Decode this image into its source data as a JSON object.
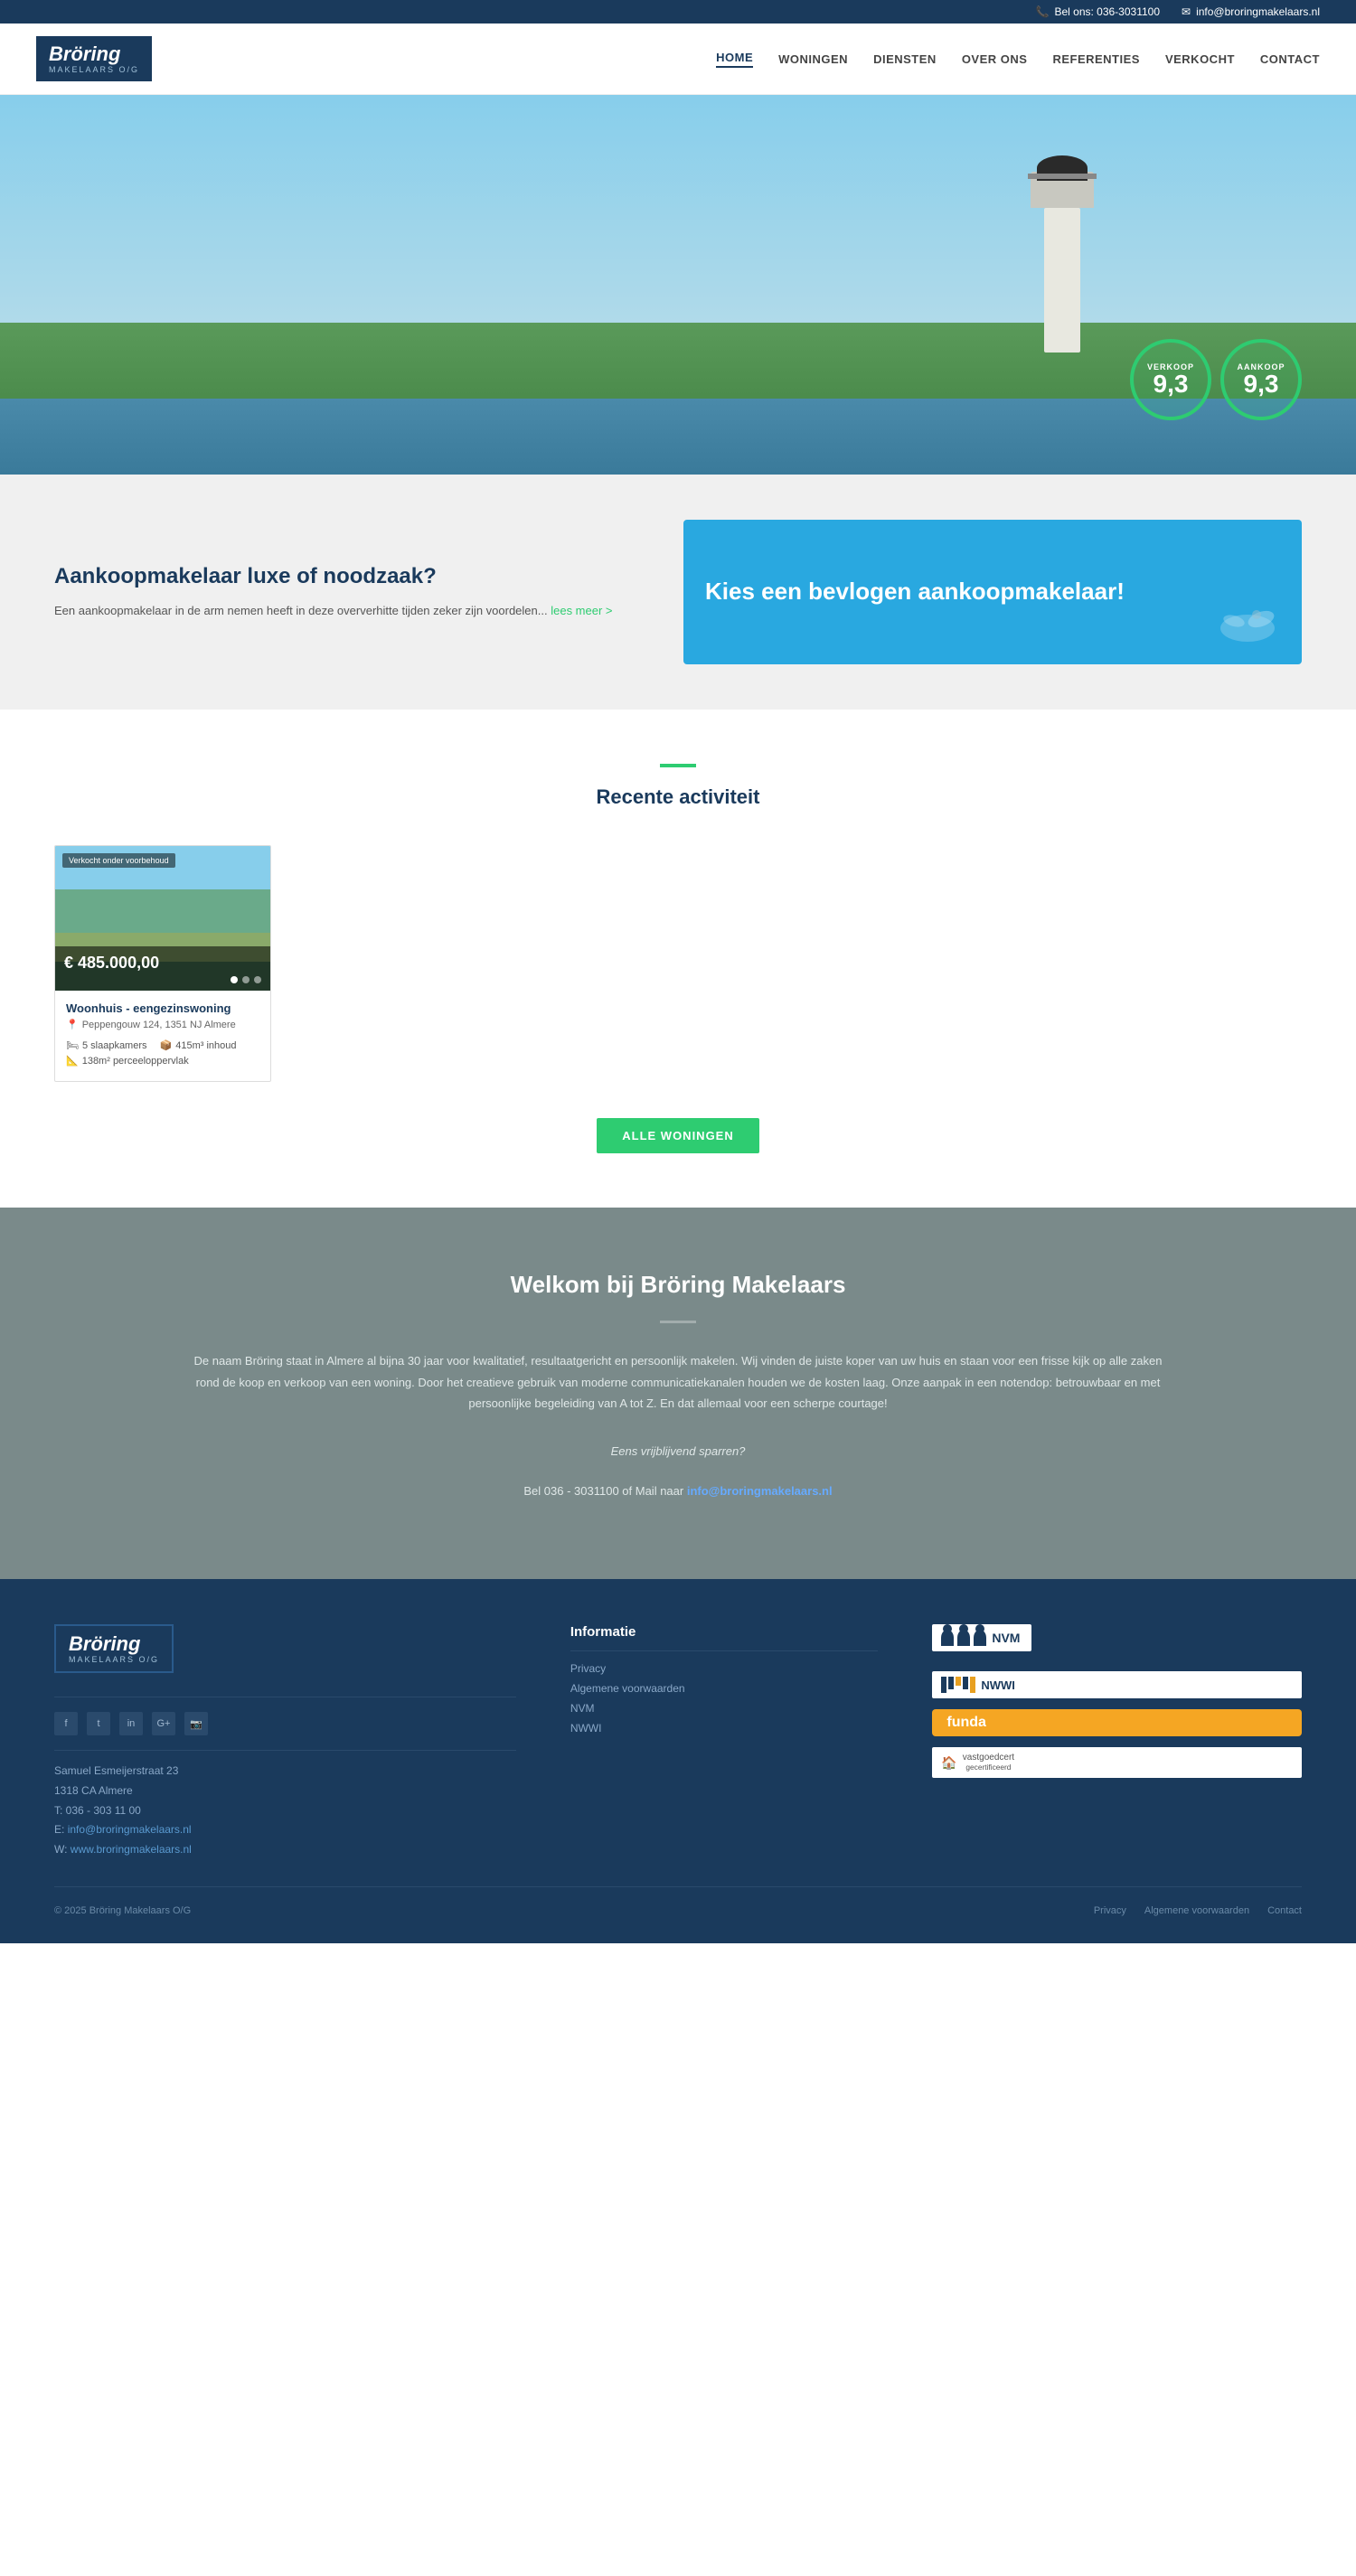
{
  "topbar": {
    "phone_icon": "📞",
    "phone": "Bel ons: 036-3031100",
    "email_icon": "✉",
    "email": "info@broringmakelaars.nl"
  },
  "header": {
    "logo_line1": "Bröring",
    "logo_line2": "MAKELAARS O/G",
    "nav": [
      {
        "label": "HOME",
        "active": true
      },
      {
        "label": "WONINGEN",
        "active": false
      },
      {
        "label": "DIENSTEN",
        "active": false
      },
      {
        "label": "OVER ONS",
        "active": false
      },
      {
        "label": "REFERENTIES",
        "active": false
      },
      {
        "label": "VERKOCHT",
        "active": false
      },
      {
        "label": "CONTACT",
        "active": false
      }
    ]
  },
  "hero": {
    "badge_verkoop_label": "VERKOOP",
    "badge_verkoop_score": "9,3",
    "badge_aankoop_label": "AANKOOP",
    "badge_aankoop_score": "9,3"
  },
  "promo": {
    "heading": "Aankoopmakelaar luxe of noodzaak?",
    "body": "Een aankoopmakelaar in de arm nemen heeft in deze oververhitte tijden zeker zijn voordelen...",
    "link_text": "lees meer >",
    "banner_text": "Kies een bevlogen aankoopmakelaar!"
  },
  "recent": {
    "accent": true,
    "title": "Recente activiteit",
    "property": {
      "sold_label": "Verkocht onder voorbehoud",
      "price": "€ 485.000,00",
      "type": "Woonhuis - eengezinswoning",
      "address": "Peppengouw 124, 1351 NJ Almere",
      "bedrooms": "5 slaapkamers",
      "content": "415m³ inhoud",
      "area": "138m² perceeloppervlak"
    },
    "button_label": "ALLE WONINGEN"
  },
  "welcome": {
    "title": "Welkom bij Bröring Makelaars",
    "body": "De naam Bröring staat in Almere al bijna 30 jaar voor kwalitatief, resultaatgericht en persoonlijk makelen. Wij vinden de juiste koper van uw huis en staan voor een frisse kijk op alle zaken rond de koop en verkoop van een woning. Door het creatieve gebruik van moderne communicatiekanalen houden we de kosten laag. Onze aanpak in een notendop: betrouwbaar en met persoonlijke begeleiding van A tot Z. En dat allemaal voor een scherpe courtage!",
    "sparren": "Eens vrijblijvend sparren?",
    "contact_text": "Bel 036 - 3031100 of Mail naar ",
    "contact_email": "info@broringmakelaars.nl"
  },
  "footer": {
    "logo_line1": "Bröring",
    "logo_line2": "MAKELAARS O/G",
    "social": [
      "f",
      "t",
      "in",
      "G+",
      "📷"
    ],
    "address_name": "Samuel Esmeijerstraat 23",
    "address_city": "1318 CA Almere",
    "phone": "T: 036 - 303 11 00",
    "email_label": "E:",
    "email": "info@broringmakelaars.nl",
    "website_label": "W:",
    "website": "www.broringmakelaars.nl",
    "info_title": "Informatie",
    "info_links": [
      {
        "label": "Privacy"
      },
      {
        "label": "Algemene voorwaarden"
      },
      {
        "label": "NVM"
      },
      {
        "label": "NWWI"
      }
    ],
    "partners": [
      "NVM",
      "NWWI",
      "funda",
      "vastgoed cert"
    ],
    "copyright": "© 2025 Bröring Makelaars O/G",
    "bottom_links": [
      "Privacy",
      "Algemene voorwaarden",
      "Contact"
    ]
  }
}
